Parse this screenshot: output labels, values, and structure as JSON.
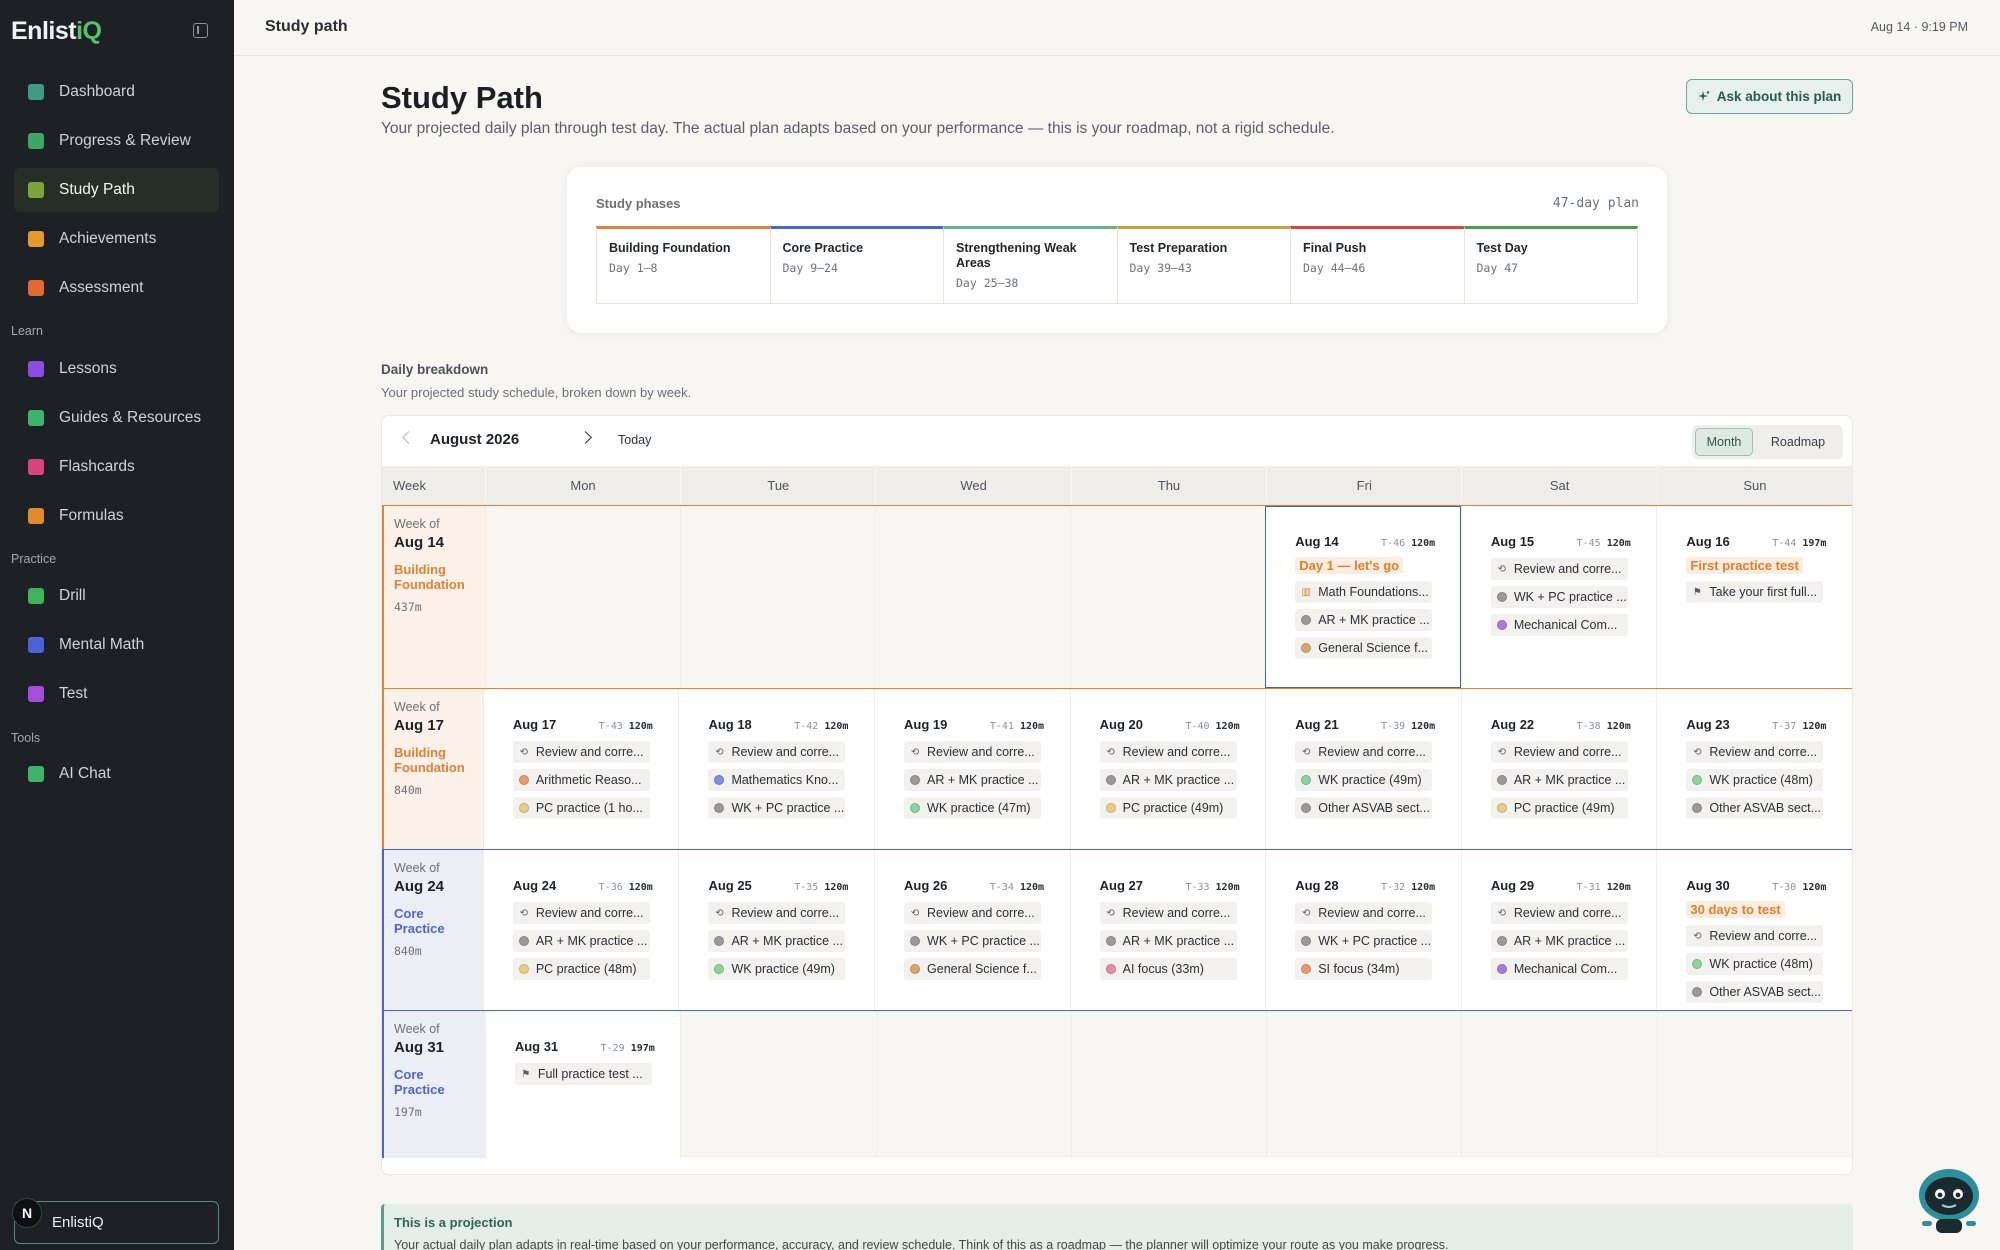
{
  "app": {
    "brand": "Enlist",
    "brand_accent": "iQ",
    "accent_color": "#4d8f7f"
  },
  "sidebar": {
    "primary": [
      {
        "label": "Dashboard",
        "icon": "home-icon",
        "color": "#3f9b86"
      },
      {
        "label": "Progress & Review",
        "icon": "bar-chart-icon",
        "color": "#3fa563"
      },
      {
        "label": "Study Path",
        "icon": "calendar-icon",
        "color": "#7fa33b",
        "active": true
      },
      {
        "label": "Achievements",
        "icon": "trophy-icon",
        "color": "#e39a2f"
      },
      {
        "label": "Assessment",
        "icon": "target-icon",
        "color": "#e1682f"
      }
    ],
    "learn_label": "Learn",
    "learn": [
      {
        "label": "Lessons",
        "icon": "book-icon",
        "color": "#8d4de0"
      },
      {
        "label": "Guides & Resources",
        "icon": "signpost-icon",
        "color": "#3fb36b"
      },
      {
        "label": "Flashcards",
        "icon": "cards-icon",
        "color": "#d6457a"
      },
      {
        "label": "Formulas",
        "icon": "formula-icon",
        "color": "#e08a2c"
      }
    ],
    "practice_label": "Practice",
    "practice": [
      {
        "label": "Drill",
        "icon": "bug-icon",
        "color": "#3fb35e"
      },
      {
        "label": "Mental Math",
        "icon": "grid-icon",
        "color": "#4b63d6"
      },
      {
        "label": "Test",
        "icon": "clipboard-icon",
        "color": "#a64fd6"
      }
    ],
    "tools_label": "Tools",
    "tools": [
      {
        "label": "AI Chat",
        "icon": "chat-icon",
        "color": "#3fb36b"
      }
    ],
    "user": {
      "initial": "N",
      "name": "EnlistiQ"
    }
  },
  "topbar": {
    "title": "Study path",
    "datetime": "Aug 14 · 9:19 PM"
  },
  "header": {
    "title": "Study Path",
    "subtitle": "Your projected daily plan through test day. The actual plan adapts based on your performance — this is your roadmap, not a rigid schedule.",
    "ask_button": "Ask about this plan"
  },
  "phases": {
    "label": "Study phases",
    "total": "47-day plan",
    "items": [
      {
        "name": "Building Foundation",
        "range": "Day 1–8",
        "color": "#e0823a"
      },
      {
        "name": "Core Practice",
        "range": "Day 9–24",
        "color": "#4b63d6"
      },
      {
        "name": "Strengthening Weak Areas",
        "range": "Day 25–38",
        "color": "#6ab38a"
      },
      {
        "name": "Test Preparation",
        "range": "Day 39–43",
        "color": "#c9a03a"
      },
      {
        "name": "Final Push",
        "range": "Day 44–46",
        "color": "#d64545"
      },
      {
        "name": "Test Day",
        "range": "Day 47",
        "color": "#4f9a55"
      }
    ]
  },
  "breakdown": {
    "title": "Daily breakdown",
    "subtitle": "Your projected study schedule, broken down by week.",
    "month": "August 2026",
    "today_label": "Today",
    "view_month": "Month",
    "view_roadmap": "Roadmap",
    "headers": [
      "Week",
      "Mon",
      "Tue",
      "Wed",
      "Thu",
      "Fri",
      "Sat",
      "Sun"
    ],
    "week_of_label": "Week of",
    "weeks": [
      {
        "date": "Aug 14",
        "phase": "Building Foundation",
        "minutes": "437m",
        "phase_color": "#e0823a",
        "bg": "#fbf1e8",
        "days": [
          null,
          null,
          null,
          null,
          {
            "date": "Aug 14",
            "t": "T-46",
            "min": "120m",
            "today": true,
            "milestone": "Day 1 — let's go",
            "tasks": [
              {
                "kind": "glyph",
                "glyph": "▥",
                "glyph_color": "#e0823a",
                "text": "Math Foundations..."
              },
              {
                "kind": "dot",
                "color": "#9a9a9a",
                "text": "AR + MK practice ..."
              },
              {
                "kind": "dot",
                "color": "#d9a66c",
                "text": "General Science f..."
              }
            ]
          },
          {
            "date": "Aug 15",
            "t": "T-45",
            "min": "120m",
            "tasks": [
              {
                "kind": "glyph",
                "glyph": "⟲",
                "text": "Review and corre..."
              },
              {
                "kind": "dot",
                "color": "#9a9a9a",
                "text": "WK + PC practice ..."
              },
              {
                "kind": "dot",
                "color": "#a77ad9",
                "text": "Mechanical Com..."
              }
            ]
          },
          {
            "date": "Aug 16",
            "t": "T-44",
            "min": "197m",
            "milestone": "First practice test",
            "tasks": [
              {
                "kind": "glyph",
                "glyph": "⚑",
                "text": "Take your first full..."
              }
            ]
          }
        ]
      },
      {
        "date": "Aug 17",
        "phase": "Building Foundation",
        "minutes": "840m",
        "phase_color": "#e0823a",
        "bg": "#fbf1e8",
        "days": [
          {
            "date": "Aug 17",
            "t": "T-43",
            "min": "120m",
            "tasks": [
              {
                "kind": "glyph",
                "glyph": "⟲",
                "text": "Review and corre..."
              },
              {
                "kind": "dot",
                "color": "#e59a72",
                "text": "Arithmetic Reaso..."
              },
              {
                "kind": "dot",
                "color": "#eccb8a",
                "text": "PC practice (1 ho..."
              }
            ]
          },
          {
            "date": "Aug 18",
            "t": "T-42",
            "min": "120m",
            "tasks": [
              {
                "kind": "glyph",
                "glyph": "⟲",
                "text": "Review and corre..."
              },
              {
                "kind": "dot",
                "color": "#7d8fe0",
                "text": "Mathematics Kno..."
              },
              {
                "kind": "dot",
                "color": "#9a9a9a",
                "text": "WK + PC practice ..."
              }
            ]
          },
          {
            "date": "Aug 19",
            "t": "T-41",
            "min": "120m",
            "tasks": [
              {
                "kind": "glyph",
                "glyph": "⟲",
                "text": "Review and corre..."
              },
              {
                "kind": "dot",
                "color": "#9a9a9a",
                "text": "AR + MK practice ..."
              },
              {
                "kind": "dot",
                "color": "#8ed39a",
                "text": "WK practice (47m)"
              }
            ]
          },
          {
            "date": "Aug 20",
            "t": "T-40",
            "min": "120m",
            "tasks": [
              {
                "kind": "glyph",
                "glyph": "⟲",
                "text": "Review and corre..."
              },
              {
                "kind": "dot",
                "color": "#9a9a9a",
                "text": "AR + MK practice ..."
              },
              {
                "kind": "dot",
                "color": "#eccb8a",
                "text": "PC practice (49m)"
              }
            ]
          },
          {
            "date": "Aug 21",
            "t": "T-39",
            "min": "120m",
            "tasks": [
              {
                "kind": "glyph",
                "glyph": "⟲",
                "text": "Review and corre..."
              },
              {
                "kind": "dot",
                "color": "#8ed39a",
                "text": "WK practice (49m)"
              },
              {
                "kind": "dot",
                "color": "#9a9a9a",
                "text": "Other ASVAB sect..."
              }
            ]
          },
          {
            "date": "Aug 22",
            "t": "T-38",
            "min": "120m",
            "tasks": [
              {
                "kind": "glyph",
                "glyph": "⟲",
                "text": "Review and corre..."
              },
              {
                "kind": "dot",
                "color": "#9a9a9a",
                "text": "AR + MK practice ..."
              },
              {
                "kind": "dot",
                "color": "#eccb8a",
                "text": "PC practice (49m)"
              }
            ]
          },
          {
            "date": "Aug 23",
            "t": "T-37",
            "min": "120m",
            "tasks": [
              {
                "kind": "glyph",
                "glyph": "⟲",
                "text": "Review and corre..."
              },
              {
                "kind": "dot",
                "color": "#8ed39a",
                "text": "WK practice (48m)"
              },
              {
                "kind": "dot",
                "color": "#9a9a9a",
                "text": "Other ASVAB sect..."
              }
            ]
          }
        ]
      },
      {
        "date": "Aug 24",
        "phase": "Core Practice",
        "minutes": "840m",
        "phase_color": "#4b63d6",
        "bg": "#eceef6",
        "days": [
          {
            "date": "Aug 24",
            "t": "T-36",
            "min": "120m",
            "tasks": [
              {
                "kind": "glyph",
                "glyph": "⟲",
                "text": "Review and corre..."
              },
              {
                "kind": "dot",
                "color": "#9a9a9a",
                "text": "AR + MK practice ..."
              },
              {
                "kind": "dot",
                "color": "#eccb8a",
                "text": "PC practice (48m)"
              }
            ]
          },
          {
            "date": "Aug 25",
            "t": "T-35",
            "min": "120m",
            "tasks": [
              {
                "kind": "glyph",
                "glyph": "⟲",
                "text": "Review and corre..."
              },
              {
                "kind": "dot",
                "color": "#9a9a9a",
                "text": "AR + MK practice ..."
              },
              {
                "kind": "dot",
                "color": "#8ed39a",
                "text": "WK practice (49m)"
              }
            ]
          },
          {
            "date": "Aug 26",
            "t": "T-34",
            "min": "120m",
            "tasks": [
              {
                "kind": "glyph",
                "glyph": "⟲",
                "text": "Review and corre..."
              },
              {
                "kind": "dot",
                "color": "#9a9a9a",
                "text": "WK + PC practice ..."
              },
              {
                "kind": "dot",
                "color": "#d9a66c",
                "text": "General Science f..."
              }
            ]
          },
          {
            "date": "Aug 27",
            "t": "T-33",
            "min": "120m",
            "tasks": [
              {
                "kind": "glyph",
                "glyph": "⟲",
                "text": "Review and corre..."
              },
              {
                "kind": "dot",
                "color": "#9a9a9a",
                "text": "AR + MK practice ..."
              },
              {
                "kind": "dot",
                "color": "#e88aa6",
                "text": "AI focus (33m)"
              }
            ]
          },
          {
            "date": "Aug 28",
            "t": "T-32",
            "min": "120m",
            "tasks": [
              {
                "kind": "glyph",
                "glyph": "⟲",
                "text": "Review and corre..."
              },
              {
                "kind": "dot",
                "color": "#9a9a9a",
                "text": "WK + PC practice ..."
              },
              {
                "kind": "dot",
                "color": "#e59a72",
                "text": "SI focus (34m)"
              }
            ]
          },
          {
            "date": "Aug 29",
            "t": "T-31",
            "min": "120m",
            "tasks": [
              {
                "kind": "glyph",
                "glyph": "⟲",
                "text": "Review and corre..."
              },
              {
                "kind": "dot",
                "color": "#9a9a9a",
                "text": "AR + MK practice ..."
              },
              {
                "kind": "dot",
                "color": "#a77ad9",
                "text": "Mechanical Com..."
              }
            ]
          },
          {
            "date": "Aug 30",
            "t": "T-30",
            "min": "120m",
            "milestone": "30 days to test",
            "tasks": [
              {
                "kind": "glyph",
                "glyph": "⟲",
                "text": "Review and corre..."
              },
              {
                "kind": "dot",
                "color": "#8ed39a",
                "text": "WK practice (48m)"
              },
              {
                "kind": "dot",
                "color": "#9a9a9a",
                "text": "Other ASVAB sect..."
              }
            ]
          }
        ]
      },
      {
        "date": "Aug 31",
        "phase": "Core Practice",
        "minutes": "197m",
        "phase_color": "#4b63d6",
        "bg": "#eceef6",
        "days": [
          {
            "date": "Aug 31",
            "t": "T-29",
            "min": "197m",
            "tasks": [
              {
                "kind": "glyph",
                "glyph": "⚑",
                "text": "Full practice test ..."
              }
            ]
          },
          null,
          null,
          null,
          null,
          null,
          null
        ]
      }
    ]
  },
  "projection": {
    "title": "This is a projection",
    "text": "Your actual daily plan adapts in real-time based on your performance, accuracy, and review schedule. Think of this as a roadmap — the planner will optimize your route as you make progress."
  }
}
